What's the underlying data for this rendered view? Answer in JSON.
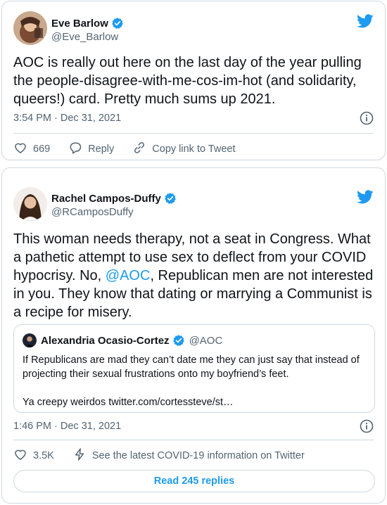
{
  "colors": {
    "accent": "#1d9bf0",
    "text": "#0f1419",
    "muted": "#536471",
    "border": "#cfd9de"
  },
  "tweets": [
    {
      "author": {
        "name": "Eve Barlow",
        "handle": "@Eve_Barlow",
        "verified": true
      },
      "text": "AOC is really out here on the last day of the year pulling the people-disagree-with-me-cos-im-hot (and solidarity, queers!) card. Pretty much sums up 2021.",
      "timestamp": "3:54 PM · Dec 31, 2021",
      "actions": {
        "likes": "669",
        "reply_label": "Reply",
        "copy_label": "Copy link to Tweet"
      }
    },
    {
      "author": {
        "name": "Rachel Campos-Duffy",
        "handle": "@RCamposDuffy",
        "verified": true
      },
      "text_before_mention": "This woman needs therapy, not a seat in Congress. What a pathetic attempt to use sex to deflect from your COVID hypocrisy. No, ",
      "mention": "@AOC",
      "text_after_mention": ", Republican men are not interested in you. They know that dating or marrying a Communist is a recipe for misery.",
      "quoted": {
        "author": {
          "name": "Alexandria Ocasio-Cortez",
          "handle": "@AOC",
          "verified": true
        },
        "line1": "If Republicans are mad they can’t date me they can just say that instead of projecting their sexual frustrations onto my boyfriend’s feet.",
        "line2": "Ya creepy weirdos twitter.com/cortessteve/st…"
      },
      "timestamp": "1:46 PM · Dec 31, 2021",
      "actions": {
        "likes": "3.5K",
        "covid_label": "See the latest COVID-19 information on Twitter"
      },
      "read_replies": "Read 245 replies"
    }
  ],
  "icons": [
    "twitter-bird-icon",
    "verified-badge-icon",
    "info-icon",
    "heart-icon",
    "reply-icon",
    "link-icon",
    "bolt-icon"
  ]
}
